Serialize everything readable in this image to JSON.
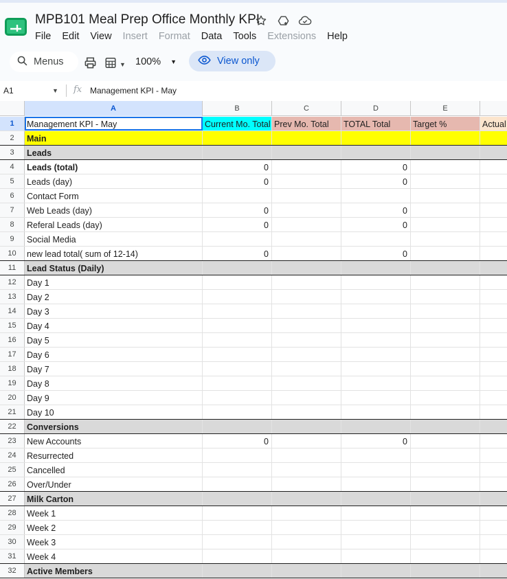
{
  "app": {
    "doc_title": "MPB101 Meal Prep Office Monthly KPI",
    "menus": [
      "File",
      "Edit",
      "View",
      "Insert",
      "Format",
      "Data",
      "Tools",
      "Extensions",
      "Help"
    ],
    "disabled_menus": [
      "Insert",
      "Format",
      "Extensions"
    ],
    "icons": [
      "sheets-logo-icon",
      "star-icon",
      "move-to-drive-icon",
      "cloud-status-icon"
    ],
    "brand_color": "#0f9d58"
  },
  "toolbar": {
    "search_label": "Menus",
    "zoom": "100%",
    "view_only_label": "View only",
    "accent": "#0b57d0"
  },
  "formula_bar": {
    "name_box": "A1",
    "fx_label": "fx",
    "content": "Management KPI - May"
  },
  "columns": [
    "A",
    "B",
    "C",
    "D",
    "E"
  ],
  "header_row": {
    "a": "Management KPI - May",
    "b": "Current Mo. Total",
    "c": "Prev Mo. Total",
    "d": "TOTAL Total",
    "e": "Target %",
    "f": "Actual",
    "colors": {
      "b": "#00ffff",
      "c": "#e6b8af",
      "d": "#e6b8af",
      "e": "#e6b8af",
      "f": "#fce5cd"
    }
  },
  "rows": [
    {
      "n": "2",
      "a": "Main",
      "style": "yellow"
    },
    {
      "n": "3",
      "a": "Leads",
      "style": "gray"
    },
    {
      "n": "4",
      "a": "Leads (total)",
      "b": "0",
      "d": "0",
      "bold": true
    },
    {
      "n": "5",
      "a": "Leads (day)",
      "b": "0",
      "d": "0"
    },
    {
      "n": "6",
      "a": "Contact Form"
    },
    {
      "n": "7",
      "a": "Web Leads (day)",
      "b": "0",
      "d": "0"
    },
    {
      "n": "8",
      "a": "Referal Leads (day)",
      "b": "0",
      "d": "0"
    },
    {
      "n": "9",
      "a": "Social Media"
    },
    {
      "n": "10",
      "a": "new lead total( sum of 12-14)",
      "b": "0",
      "d": "0"
    },
    {
      "n": "11",
      "a": "Lead Status (Daily)",
      "style": "gray"
    },
    {
      "n": "12",
      "a": "Day 1"
    },
    {
      "n": "13",
      "a": "Day 2"
    },
    {
      "n": "14",
      "a": "Day 3"
    },
    {
      "n": "15",
      "a": "Day 4"
    },
    {
      "n": "16",
      "a": "Day 5"
    },
    {
      "n": "17",
      "a": "Day 6"
    },
    {
      "n": "18",
      "a": "Day 7"
    },
    {
      "n": "19",
      "a": "Day 8"
    },
    {
      "n": "20",
      "a": "Day 9"
    },
    {
      "n": "21",
      "a": "Day 10"
    },
    {
      "n": "22",
      "a": "Conversions",
      "style": "gray"
    },
    {
      "n": "23",
      "a": "New Accounts",
      "b": "0",
      "d": "0"
    },
    {
      "n": "24",
      "a": "Resurrected"
    },
    {
      "n": "25",
      "a": "Cancelled"
    },
    {
      "n": "26",
      "a": "Over/Under"
    },
    {
      "n": "27",
      "a": "Milk Carton",
      "style": "gray"
    },
    {
      "n": "28",
      "a": "Week 1"
    },
    {
      "n": "29",
      "a": "Week 2"
    },
    {
      "n": "30",
      "a": "Week 3"
    },
    {
      "n": "31",
      "a": "Week 4"
    },
    {
      "n": "32",
      "a": "Active Members",
      "style": "gray"
    }
  ]
}
